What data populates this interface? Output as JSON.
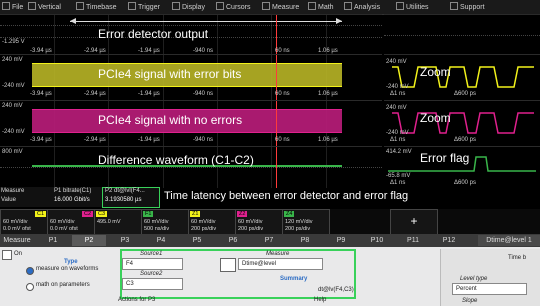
{
  "menubar": {
    "items": [
      "File",
      "Vertical",
      "Timebase",
      "Trigger",
      "Display",
      "Cursors",
      "Measure",
      "Math",
      "Analysis",
      "Utilities",
      "Support"
    ]
  },
  "panes": {
    "top": {
      "scale_top": "",
      "scale_bottom": "-1.295 V",
      "title": "Error detector output",
      "times": [
        "-3.94 µs",
        "-2.94 µs",
        "-1.94 µs",
        "-940 ns",
        "60 ns",
        "1.06 µs"
      ]
    },
    "p1": {
      "scale_top": "240 mV",
      "scale_bottom": "-240 mV",
      "title": "PCIe4 signal with error bits",
      "times": [
        "-3.94 µs",
        "-2.94 µs",
        "-1.94 µs",
        "-940 ns",
        "60 ns",
        "1.06 µs"
      ]
    },
    "p2": {
      "scale_top": "240 mV",
      "scale_bottom": "-240 mV",
      "title": "PCIe4 signal with no errors",
      "times": [
        "-3.94 µs",
        "-2.94 µs",
        "-1.94 µs",
        "-940 ns",
        "60 ns",
        "1.06 µs"
      ]
    },
    "p3": {
      "scale_top": "800 mV",
      "scale_bottom": "",
      "title": "Difference waveform (C1-C2)",
      "times": []
    }
  },
  "zoom": {
    "z1": {
      "top": "240 mV",
      "bottom": "-240 mV",
      "label": "Zoom",
      "left": "Δ1 ns",
      "right": "Δ600 ps"
    },
    "z2": {
      "top": "240 mV",
      "bottom": "-240 mV",
      "label": "Zoom",
      "left": "Δ1 ns",
      "right": "Δ600 ps"
    },
    "z3": {
      "top": "414.2 mV",
      "bottom": "-65.8 mV",
      "label": "Error flag",
      "left": "Δ1 ns",
      "right": "Δ600 ps"
    }
  },
  "measure_table": {
    "header": "Measure",
    "col1": "P1 bitrate(C1)",
    "col2": "P2 dt@lvl(F4...",
    "row_value_label": "Value",
    "val1": "16.000 Gbit/s",
    "val2": "3.1930580 µs"
  },
  "latency_caption": "Time latency between error detector and error flag",
  "channel_strip": [
    {
      "tag": "C1",
      "color": "#f2f21a",
      "l1": "60 mV/div",
      "l2": "0.0 mV ofst"
    },
    {
      "tag": "C2",
      "color": "#e0208e",
      "l1": "60 mV/div",
      "l2": "0.0 mV ofst"
    },
    {
      "tag": "C3",
      "color": "#f2f21a",
      "l1": "495.0 mV",
      "l2": ""
    },
    {
      "tag": "F1",
      "color": "#39b54a",
      "l1": "60 mV/div",
      "l2": "500 ns/div"
    },
    {
      "tag": "Z1",
      "color": "#f2f21a",
      "l1": "60 mV/div",
      "l2": "200 ps/div"
    },
    {
      "tag": "Z2",
      "color": "#e0208e",
      "l1": "60 mV/div",
      "l2": "200 ps/div"
    },
    {
      "tag": "Z4",
      "color": "#39b54a",
      "l1": "120 mV/div",
      "l2": "200 ps/div"
    }
  ],
  "tabs": [
    "Measure",
    "P1",
    "P2",
    "P3",
    "P4",
    "P5",
    "P6",
    "P7",
    "P8",
    "P9",
    "P10",
    "P11",
    "P12"
  ],
  "active_tab": "P2",
  "right_tab": "Dtime@level 1",
  "panel": {
    "on_label": "On",
    "type_label": "Type",
    "type_opt1": "measure on waveforms",
    "type_opt2": "math on parameters",
    "source1_label": "Source1",
    "source1_value": "F4",
    "source2_label": "Source2",
    "source2_value": "C3",
    "measure_label": "Measure",
    "measure_value": "Dtime@level",
    "summary_label": "Summary",
    "summary_value": "dt@lv(F4,C3)",
    "actions_label": "Actions for P3",
    "help_label": "Help",
    "time_label": "Time b",
    "level_type_label": "Level type",
    "level_type_value": "Percent",
    "slope_label": "Slope"
  }
}
